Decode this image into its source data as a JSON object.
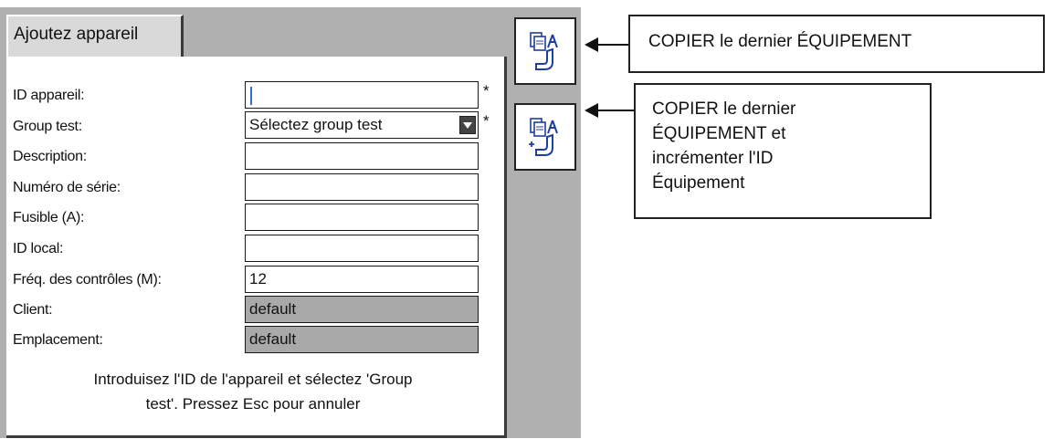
{
  "tab": {
    "label": "Ajoutez appareil"
  },
  "form": {
    "fields": [
      {
        "label": "ID appareil:",
        "value": "",
        "required": "*"
      },
      {
        "label": "Group test:",
        "value": "Sélectez group test",
        "required": "*"
      },
      {
        "label": "Description:",
        "value": ""
      },
      {
        "label": "Numéro de série:",
        "value": ""
      },
      {
        "label": "Fusible (A):",
        "value": ""
      },
      {
        "label": "ID local:",
        "value": ""
      },
      {
        "label": "Fréq. des contrôles (M):",
        "value": "12"
      },
      {
        "label": "Client:",
        "value": "default"
      },
      {
        "label": "Emplacement:",
        "value": "default"
      }
    ],
    "help_line1": "Introduisez l'ID de l'appareil et sélectez 'Group",
    "help_line2": "test'.  Pressez Esc pour annuler"
  },
  "side_buttons": [
    {
      "icon": "copy-equipment-icon"
    },
    {
      "icon": "copy-increment-equipment-icon"
    }
  ],
  "callouts": {
    "copy_last": "COPIER le dernier ÉQUIPEMENT",
    "copy_increment": [
      "COPIER le dernier",
      "ÉQUIPEMENT et",
      "incrémenter l'ID",
      "Équipement"
    ]
  },
  "colors": {
    "panel_bg": "#b0b0b0",
    "readonly_field": "#a9a9a9",
    "caret": "#2f6fd0",
    "icon_blue": "#1f3f9f"
  }
}
